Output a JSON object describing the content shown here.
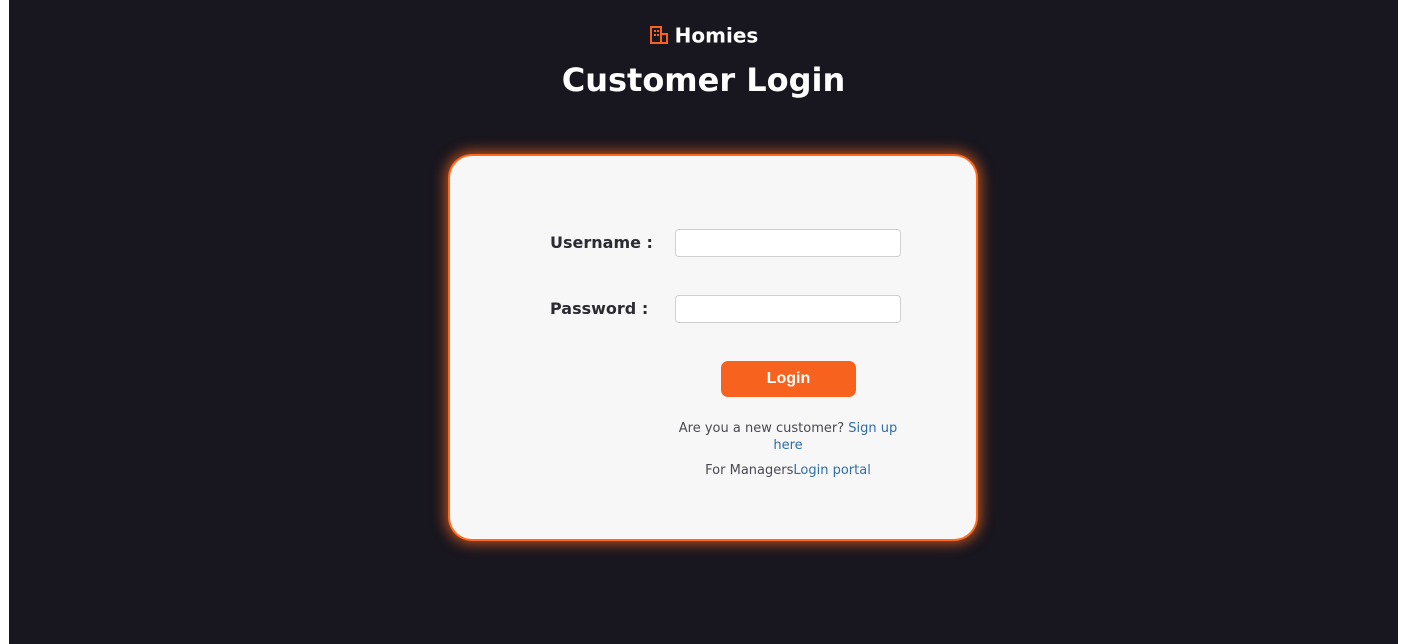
{
  "brand": {
    "name": "Homies",
    "icon": "building-icon",
    "accent_color": "#f7631f"
  },
  "page": {
    "title": "Customer Login",
    "background_color": "#18161f"
  },
  "form": {
    "username_label": "Username :",
    "username_value": "",
    "password_label": "Password :",
    "password_value": "",
    "login_label": "Login"
  },
  "footer": {
    "signup_prompt": "Are you a new customer? ",
    "signup_link": "Sign up here",
    "managers_prompt": "For Managers",
    "managers_link": "Login portal"
  }
}
